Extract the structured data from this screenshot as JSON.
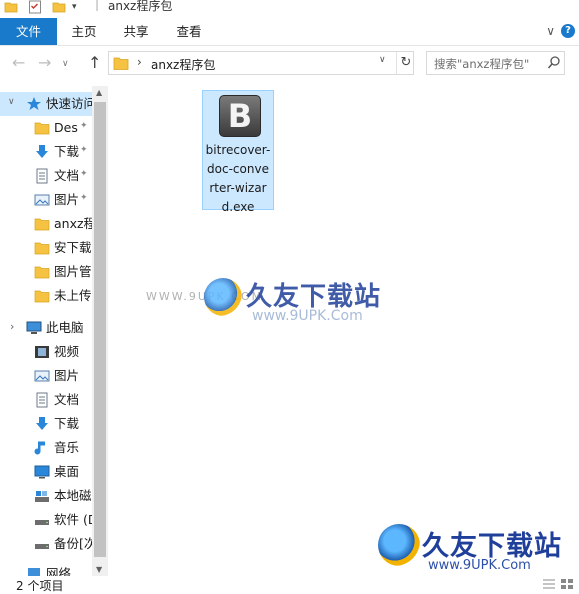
{
  "window": {
    "title": "anxz程序包"
  },
  "ribbon": {
    "tabs": [
      {
        "label": "文件"
      },
      {
        "label": "主页"
      },
      {
        "label": "共享"
      },
      {
        "label": "查看"
      }
    ],
    "collapse_glyph": "∨",
    "help_glyph": "?"
  },
  "nav": {
    "back_glyph": "←",
    "forward_glyph": "→",
    "recent_glyph": "∨",
    "up_glyph": "↑",
    "address_sep": "›",
    "address_path": "anxz程序包",
    "address_drop": "∨",
    "refresh_glyph": "↻",
    "search_placeholder": "搜索\"anxz程序包\""
  },
  "sidebar": {
    "items": [
      {
        "label": "快速访问",
        "icon": "star-icon",
        "expand": "∨"
      },
      {
        "label": "Des",
        "icon": "folder-icon",
        "pinned": true
      },
      {
        "label": "下载",
        "icon": "download-icon",
        "pinned": true
      },
      {
        "label": "文档",
        "icon": "document-icon",
        "pinned": true
      },
      {
        "label": "图片",
        "icon": "picture-icon",
        "pinned": true
      },
      {
        "label": "anxz程",
        "icon": "folder-icon"
      },
      {
        "label": "安下载",
        "icon": "folder-icon"
      },
      {
        "label": "图片管",
        "icon": "folder-icon"
      },
      {
        "label": "未上传",
        "icon": "folder-icon"
      },
      {
        "label": "此电脑",
        "icon": "computer-icon",
        "expand": "›"
      },
      {
        "label": "视频",
        "icon": "video-icon"
      },
      {
        "label": "图片",
        "icon": "picture-icon"
      },
      {
        "label": "文档",
        "icon": "document-icon"
      },
      {
        "label": "下载",
        "icon": "download-icon"
      },
      {
        "label": "音乐",
        "icon": "music-icon"
      },
      {
        "label": "桌面",
        "icon": "desktop-icon"
      },
      {
        "label": "本地磁",
        "icon": "drive-icon"
      },
      {
        "label": "软件 (D",
        "icon": "drive-icon"
      },
      {
        "label": "备份[次",
        "icon": "drive-icon"
      },
      {
        "label": "网络",
        "icon": "network-icon"
      }
    ],
    "pin_glyph": "✦"
  },
  "files": [
    {
      "name": "bitrecover-doc-converter-wizard.exe",
      "icon_letter": "B"
    }
  ],
  "watermarks": {
    "center": {
      "brand": "久友下载站",
      "url": "www.9UPK.Com",
      "left_text": "WWW.9UPK.COM"
    },
    "corner": {
      "brand": "久友下载站",
      "url": "www.9UPK.Com"
    }
  },
  "status": {
    "item_count": "2 个项目"
  },
  "colors": {
    "accent": "#1979ca",
    "selection": "#cce8ff",
    "folder": "#f5c242"
  }
}
